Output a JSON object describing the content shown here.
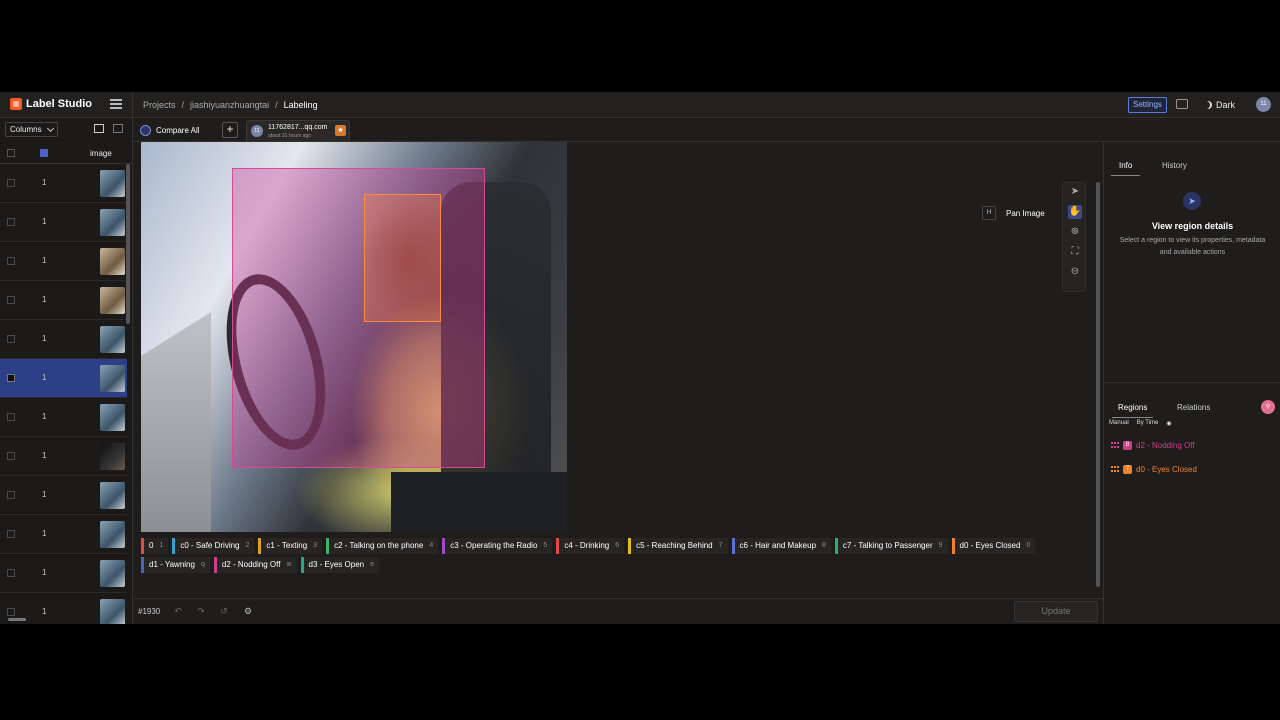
{
  "app": {
    "name": "Label Studio"
  },
  "breadcrumb": {
    "projects": "Projects",
    "sep1": "/",
    "project": "jiashiyuanzhuangtai",
    "sep2": "/",
    "current": "Labeling"
  },
  "header": {
    "settings": "Settings",
    "theme": "Dark",
    "avatar": "11"
  },
  "left": {
    "columns_label": "Columns",
    "image_header": "image",
    "rows": [
      {
        "num": "1"
      },
      {
        "num": "1"
      },
      {
        "num": "1"
      },
      {
        "num": "1"
      },
      {
        "num": "1"
      },
      {
        "num": "1"
      },
      {
        "num": "1"
      },
      {
        "num": "1"
      },
      {
        "num": "1"
      },
      {
        "num": "1"
      },
      {
        "num": "1"
      },
      {
        "num": "1"
      }
    ],
    "selected_row": 5
  },
  "tabs": {
    "compare_all": "Compare All",
    "add": "+",
    "annotation_title": "11762817...qq.com",
    "annotation_time": "about 31 hours ago",
    "annotation_avatar": "11"
  },
  "canvas": {
    "pan_key": "H",
    "pan_label": "Pan Image"
  },
  "labels": [
    {
      "name": "0",
      "hotkey": "1",
      "color": "#e04a4a"
    },
    {
      "name": "c0 - Safe Driving",
      "hotkey": "2",
      "color": "#38a3c8"
    },
    {
      "name": "c1 - Texting",
      "hotkey": "3",
      "color": "#e0a020"
    },
    {
      "name": "c2 - Talking on the phone",
      "hotkey": "4",
      "color": "#3cb46e"
    },
    {
      "name": "c3 - Operating the Radio",
      "hotkey": "5",
      "color": "#9b4dca"
    },
    {
      "name": "c4 - Drinking",
      "hotkey": "6",
      "color": "#e04a4a"
    },
    {
      "name": "c5 - Reaching Behind",
      "hotkey": "7",
      "color": "#e0c020"
    },
    {
      "name": "c6 - Hair and Makeup",
      "hotkey": "8",
      "color": "#5b6fd6"
    },
    {
      "name": "c7 - Talking to Passenger",
      "hotkey": "9",
      "color": "#2fae6a"
    },
    {
      "name": "d0 - Eyes Closed",
      "hotkey": "0",
      "color": "#f0812e"
    },
    {
      "name": "d1 - Yawning",
      "hotkey": "q",
      "color": "#4b63c9"
    },
    {
      "name": "d2 - Nodding Off",
      "hotkey": "w",
      "color": "#d13f8c"
    },
    {
      "name": "d3 - Eyes Open",
      "hotkey": "e",
      "color": "#2ca58d"
    }
  ],
  "bottom": {
    "task_id": "#1930",
    "update": "Update"
  },
  "info_panel": {
    "tab_info": "Info",
    "tab_history": "History",
    "title": "View region details",
    "subtitle": "Select a region to view its properties, metadata and available actions"
  },
  "regions_panel": {
    "tab_regions": "Regions",
    "tab_relations": "Relations",
    "sort_manual": "Manual",
    "sort_by_time": "By Time",
    "items": [
      {
        "label": "d2 - Nodding Off",
        "badge": "8",
        "color": "#d13f8c"
      },
      {
        "label": "d0 - Eyes Closed",
        "badge": "7",
        "color": "#f0812e"
      }
    ]
  }
}
